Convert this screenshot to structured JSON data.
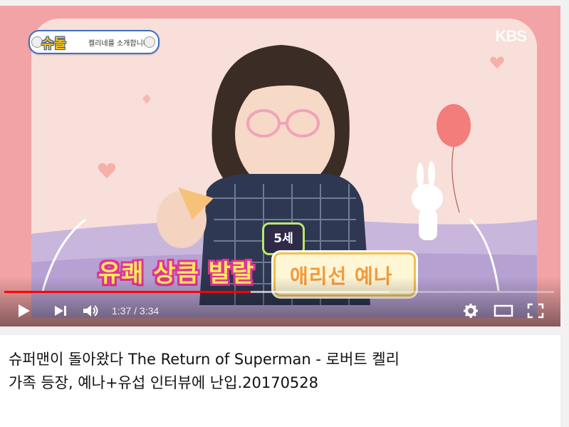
{
  "video": {
    "show_logo": "슈돌",
    "show_caption": "켈리네를 소개합니다",
    "channel_logo": "KBS",
    "subtitle_left": "유쾌 상큼 발랄",
    "age_tag": "5세",
    "name_tag": "애리선 예나",
    "progress_played_fraction": 0.448,
    "progress_loaded_fraction": 0.7
  },
  "controls": {
    "time_display": "1:37 / 3:34",
    "play_icon": "play-icon",
    "next_icon": "next-icon",
    "volume_icon": "volume-icon",
    "settings_icon": "gear-icon",
    "theater_icon": "theater-mode-icon",
    "fullscreen_icon": "fullscreen-icon"
  },
  "title": {
    "text": "슈퍼맨이 돌아왔다 The Return of Superman - 로버트 켈리 가족 등장, 예나+유섭 인터뷰에 난입.20170528"
  },
  "colors": {
    "progress": "#ff0000",
    "background": "#f2a3a5"
  }
}
